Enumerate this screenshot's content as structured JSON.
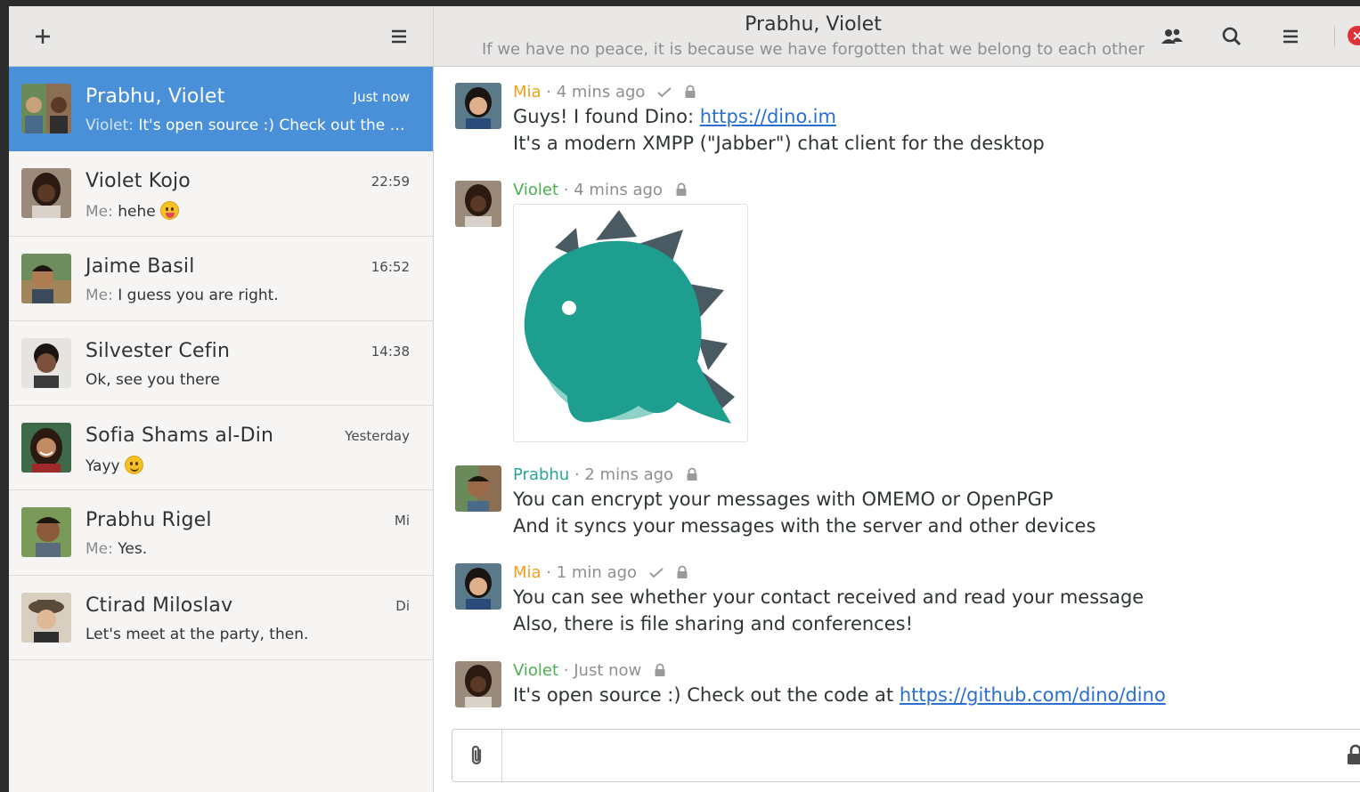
{
  "sidebar": {
    "add_label": "+",
    "conversations": [
      {
        "name": "Prabhu, Violet",
        "time": "Just now",
        "who": "Violet: ",
        "preview": "It's open source :) Check out the co…",
        "emoji": "",
        "active": true
      },
      {
        "name": "Violet Kojo",
        "time": "22:59",
        "who": "Me: ",
        "preview": "hehe",
        "emoji": "tongue",
        "active": false
      },
      {
        "name": "Jaime Basil",
        "time": "16:52",
        "who": "Me: ",
        "preview": "I guess you are right.",
        "emoji": "",
        "active": false
      },
      {
        "name": "Silvester Cefin",
        "time": "14:38",
        "who": "",
        "preview": "Ok, see you there",
        "emoji": "",
        "active": false
      },
      {
        "name": "Sofia Shams al-Din",
        "time": "Yesterday",
        "who": "",
        "preview": "Yayy",
        "emoji": "smile",
        "active": false
      },
      {
        "name": "Prabhu Rigel",
        "time": "Mi",
        "who": "Me: ",
        "preview": "Yes.",
        "emoji": "",
        "active": false
      },
      {
        "name": "Ctirad Miloslav",
        "time": "Di",
        "who": "",
        "preview": "Let's meet at the party, then.",
        "emoji": "",
        "active": false
      }
    ]
  },
  "header": {
    "title": "Prabhu, Violet",
    "subtitle": "If we have no peace, it is because we have forgotten that we belong to each other",
    "close_label": "×"
  },
  "messages": [
    {
      "sender": "Mia",
      "color": "#f0a01e",
      "time": " · 4 mins ago",
      "read": true,
      "line1_text": "Guys! I found Dino: ",
      "line1_link": "https://dino.im",
      "line2": "It's a modern XMPP (\"Jabber\") chat client for the desktop"
    },
    {
      "sender": "Violet",
      "color": "#4caf50",
      "time": " · 4 mins ago",
      "read": false
    },
    {
      "sender": "Prabhu",
      "color": "#26a69a",
      "time": " · 2 mins ago",
      "read": false,
      "line1": "You can encrypt your messages with OMEMO or OpenPGP",
      "line2": "And it syncs your messages with the server and other devices"
    },
    {
      "sender": "Mia",
      "color": "#f0a01e",
      "time": " · 1 min ago",
      "read": true,
      "line1": "You can see whether your contact received and read your message",
      "line2": "Also, there is file sharing and conferences!"
    },
    {
      "sender": "Violet",
      "color": "#4caf50",
      "time": " · Just now",
      "read": false,
      "line1_text": "It's open source :) Check out the code at ",
      "line1_link": "https://github.com/dino/dino"
    }
  ],
  "composer": {
    "placeholder": ""
  },
  "colors": {
    "accent": "#4a90d9",
    "link": "#2a6fd1",
    "dino_teal": "#1e9e8e",
    "dino_dark": "#4a5a62"
  }
}
